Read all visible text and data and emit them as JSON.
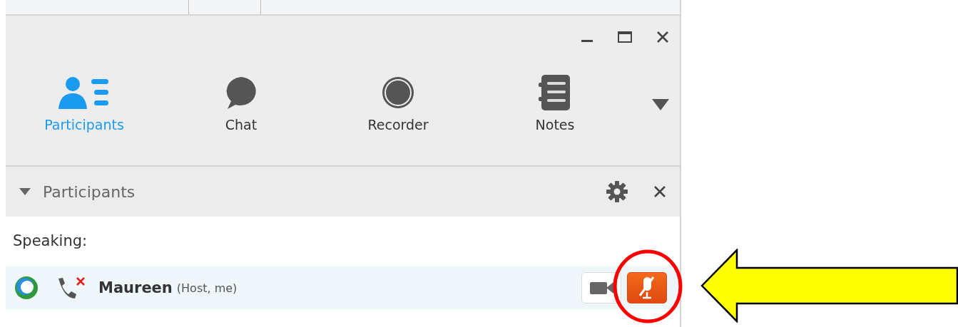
{
  "tabs": [
    {
      "label": "Participants",
      "kind": "people",
      "selected": true
    },
    {
      "label": "Chat",
      "kind": "chat",
      "selected": false
    },
    {
      "label": "Recorder",
      "kind": "record",
      "selected": false
    },
    {
      "label": "Notes",
      "kind": "notes",
      "selected": false
    }
  ],
  "panel": {
    "title": "Participants",
    "expanded": true
  },
  "section_label": "Speaking:",
  "participants": [
    {
      "name": "Maureen",
      "role": "(Host, me)",
      "phone_disconnected": true,
      "muted": true
    }
  ]
}
